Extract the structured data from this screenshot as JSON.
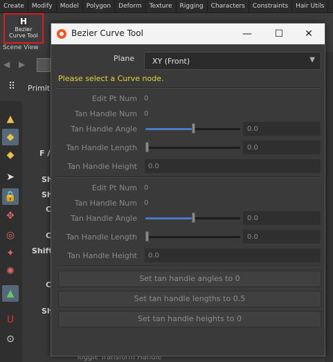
{
  "host": {
    "shelf_tabs": [
      "Create",
      "Modify",
      "Model",
      "Polygon",
      "Deform",
      "Texture",
      "Rigging",
      "Characters",
      "Constraints",
      "Hair Utils"
    ],
    "shelf_tool": {
      "icon_text": "H",
      "label_line1": "Bezier",
      "label_line2": "Curve Tool",
      "icon": "bezier-tool-icon"
    },
    "scene_view_label": "Scene View",
    "primitives_label": "Primiti",
    "side_texts": [
      "F /",
      "Sh",
      "Sh",
      "C",
      "C",
      "Shift",
      "C",
      "Sh"
    ],
    "bottom_hint": "Toggle Transform Handle"
  },
  "dialog": {
    "title": "Bezier Curve Tool",
    "window_buttons": {
      "minimize": "—",
      "maximize": "☐",
      "close": "✕"
    },
    "plane": {
      "label": "Plane",
      "value": "XY (Front)"
    },
    "warning": "Please select a Curve node.",
    "groups": [
      {
        "edit_pt_label": "Edit Pt Num",
        "edit_pt_value": "0",
        "tan_num_label": "Tan Handle Num",
        "tan_num_value": "0",
        "angle_label": "Tan Handle Angle",
        "angle_value": "0.0",
        "angle_fraction": 0.5,
        "length_label": "Tan Handle Length",
        "length_value": "0.0",
        "length_fraction": 0.0,
        "height_label": "Tan Handle Height",
        "height_value": "0.0"
      },
      {
        "edit_pt_label": "Edit Pt Num",
        "edit_pt_value": "0",
        "tan_num_label": "Tan Handle Num",
        "tan_num_value": "0",
        "angle_label": "Tan Handle Angle",
        "angle_value": "0.0",
        "angle_fraction": 0.5,
        "length_label": "Tan Handle Length",
        "length_value": "0.0",
        "length_fraction": 0.0,
        "height_label": "Tan Handle Height",
        "height_value": "0.0"
      }
    ],
    "buttons": {
      "set_angles": "Set tan handle angles to 0",
      "set_lengths": "Set tan handle lengths to 0.5",
      "set_heights": "Set tan handle heights to 0"
    }
  },
  "colors": {
    "warning": "#e5d63a",
    "slider_fill": "#4a79c8",
    "highlight": "#d81e1e",
    "accent_icon": "#f05a22"
  }
}
